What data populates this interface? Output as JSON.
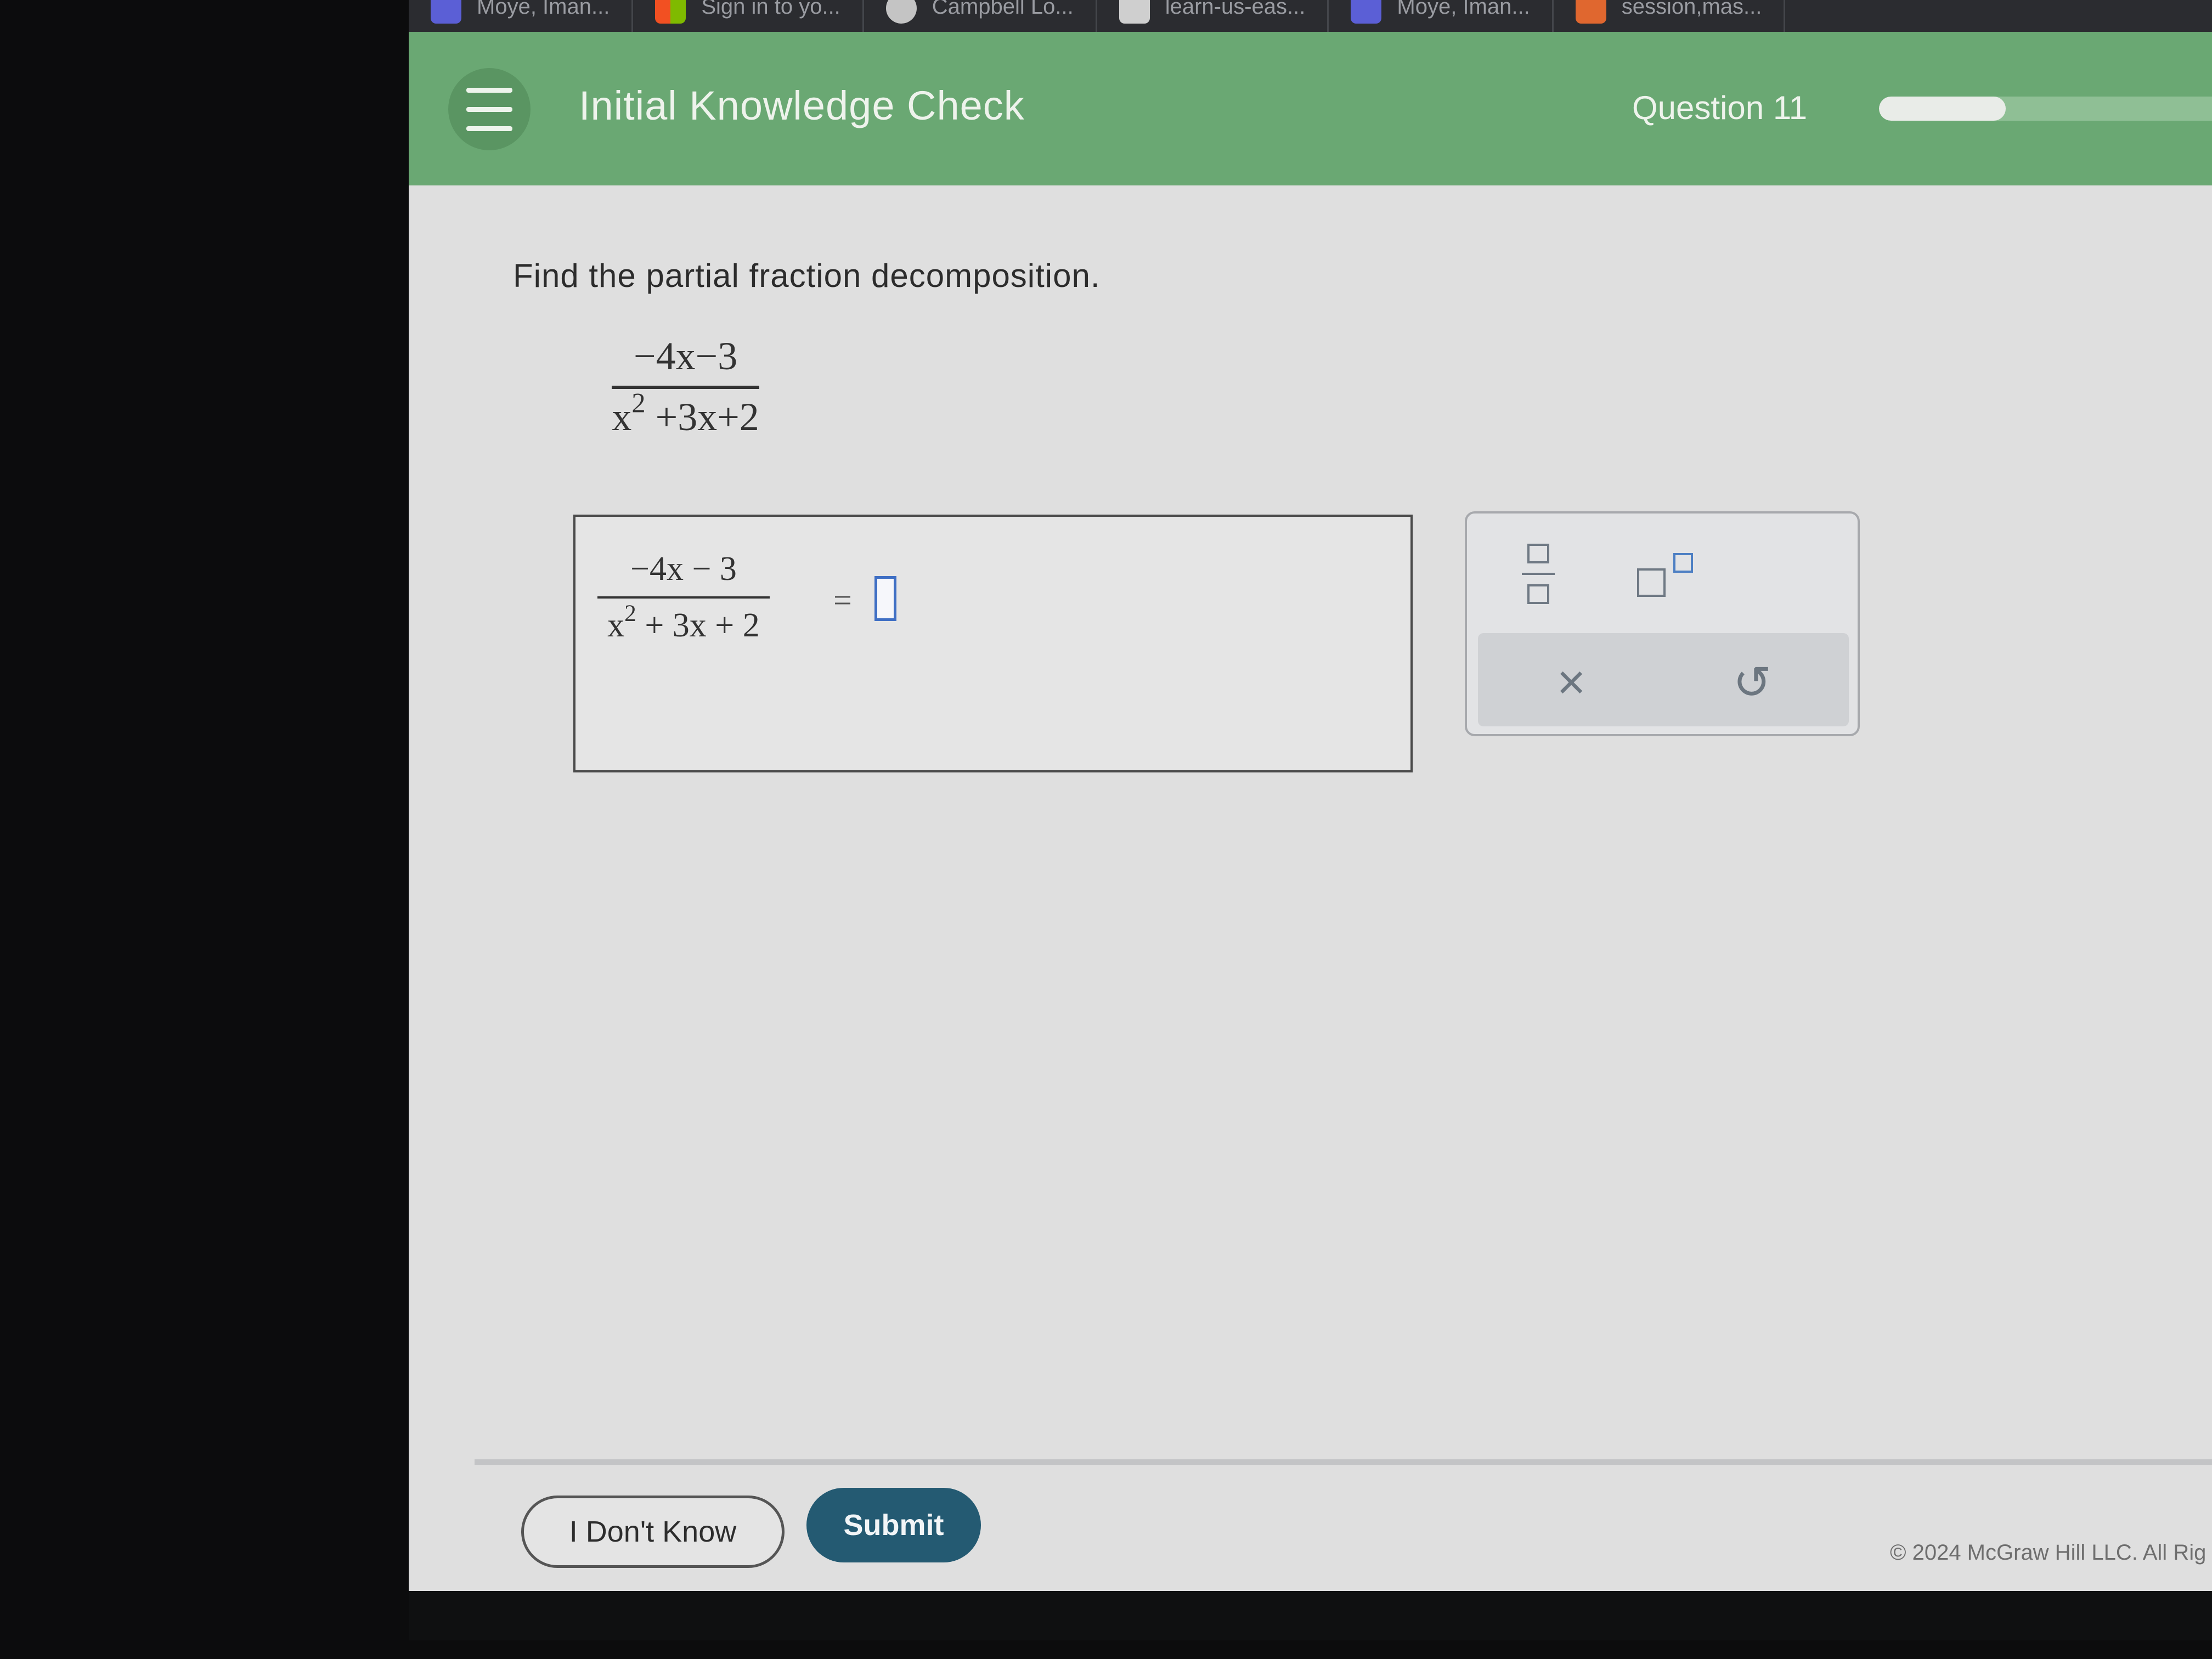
{
  "browser": {
    "bookmarks": [
      {
        "label": "Moye, Iman...",
        "icon": "colored-app-icon",
        "color": "#5b5fd6"
      },
      {
        "label": "Sign in to yo...",
        "icon": "windows-logo-icon",
        "color": "#3b8ee6"
      },
      {
        "label": "Campbell Lo...",
        "icon": "circle-logo-icon",
        "color": "#c4c4c4"
      },
      {
        "label": "learn-us-eas...",
        "icon": "box-logo-icon",
        "color": "#cfcfcf"
      },
      {
        "label": "Moye, Iman...",
        "icon": "colored-app-icon",
        "color": "#5b5fd6"
      },
      {
        "label": "session,mas...",
        "icon": "orange-app-icon",
        "color": "#e0672f"
      }
    ]
  },
  "header": {
    "title": "Initial Knowledge Check",
    "question": "Question 11",
    "progress_fraction": 0.33,
    "color": "#6aa873"
  },
  "question": {
    "prompt": "Find the partial fraction decomposition.",
    "numerator": "−4x−3",
    "denominator_base": "x",
    "denominator_exp": "2",
    "denominator_rest": " +3x+2"
  },
  "answer": {
    "numerator": "−4x − 3",
    "denominator_base": "x",
    "denominator_exp": "2",
    "denominator_rest": " + 3x + 2",
    "equals": "=",
    "slot_value": ""
  },
  "toolpad": {
    "clear_symbol": "×",
    "undo_symbol": "↺"
  },
  "footer": {
    "dont_know_label": "I Don't Know",
    "submit_label": "Submit",
    "submit_color": "#245a72",
    "copyright": "© 2024 McGraw Hill LLC. All Rig"
  }
}
